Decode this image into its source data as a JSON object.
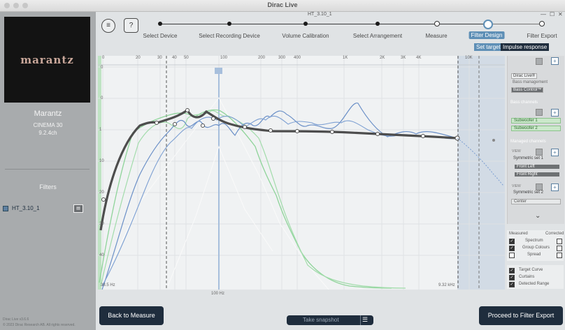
{
  "window": {
    "title": "Dirac Live",
    "project": "HT_3.10_1"
  },
  "sidebar": {
    "logo_text": "marantz",
    "device_name": "Marantz",
    "device_model": "CINEMA 30",
    "device_config": "9.2.4ch",
    "filters_heading": "Filters",
    "filters": [
      {
        "label": "HT_3.10_1"
      }
    ],
    "version": "Dirac Live v3.6.6",
    "copyright": "© 2023 Dirac Research AB. All rights reserved."
  },
  "steps": [
    {
      "label": "Select Device",
      "state": "done"
    },
    {
      "label": "Select Recording Device",
      "state": "done"
    },
    {
      "label": "Volume Calibration",
      "state": "done"
    },
    {
      "label": "Select Arrangement",
      "state": "done"
    },
    {
      "label": "Measure",
      "state": "todo"
    },
    {
      "label": "Filter Design",
      "state": "active"
    },
    {
      "label": "Filter Export",
      "state": "todo"
    }
  ],
  "subtabs": {
    "set_target": "Set target",
    "impulse_response": "Impulse response"
  },
  "plot": {
    "freq_ticks": [
      "0",
      "20",
      "30",
      "40",
      "50",
      "100",
      "200",
      "300",
      "400",
      "1K",
      "2K",
      "3K",
      "4K",
      "10K"
    ],
    "y_ticks": [
      "0",
      "0",
      "1",
      "10",
      "20",
      "30",
      "40"
    ],
    "low_limit": "38.5 Hz",
    "high_limit": "9.32 kHz",
    "cursor_label": "100 Hz"
  },
  "right_panel": {
    "group_items": [
      "Dirac Live®",
      "Bass management",
      "Bass Control™"
    ],
    "bass_channels_heading": "Bass channels",
    "bass_channels": [
      "Subwoofer 1",
      "Subwoofer 2"
    ],
    "managed_channels_heading": "Managed channels",
    "sets": [
      {
        "label": "Symmetric set 1",
        "channels": [
          "Front Left",
          "Front Right"
        ]
      },
      {
        "label": "Symmetric set 2",
        "channels": [
          "Center"
        ]
      }
    ],
    "view_label": "VIEW"
  },
  "options": {
    "measured": "Measured",
    "corrected": "Corrected",
    "rows": [
      {
        "label": "Spectrum",
        "measured": true,
        "corrected": false
      },
      {
        "label": "Group Colours",
        "measured": true,
        "corrected": false
      },
      {
        "label": "Spread",
        "measured": false,
        "corrected": false
      }
    ],
    "extras": [
      {
        "label": "Target Curve",
        "checked": true
      },
      {
        "label": "Curtains",
        "checked": true
      },
      {
        "label": "Detected Range",
        "checked": true
      }
    ]
  },
  "buttons": {
    "back": "Back to Measure",
    "snapshot": "Take snapshot",
    "proceed": "Proceed to Filter Export"
  },
  "colors": {
    "navy": "#1f2d3d",
    "accent": "#5e8fb6",
    "target_curve": "#4d4d4d",
    "measured_blue": "#6a8fc7",
    "measured_green": "#8fd49a"
  }
}
